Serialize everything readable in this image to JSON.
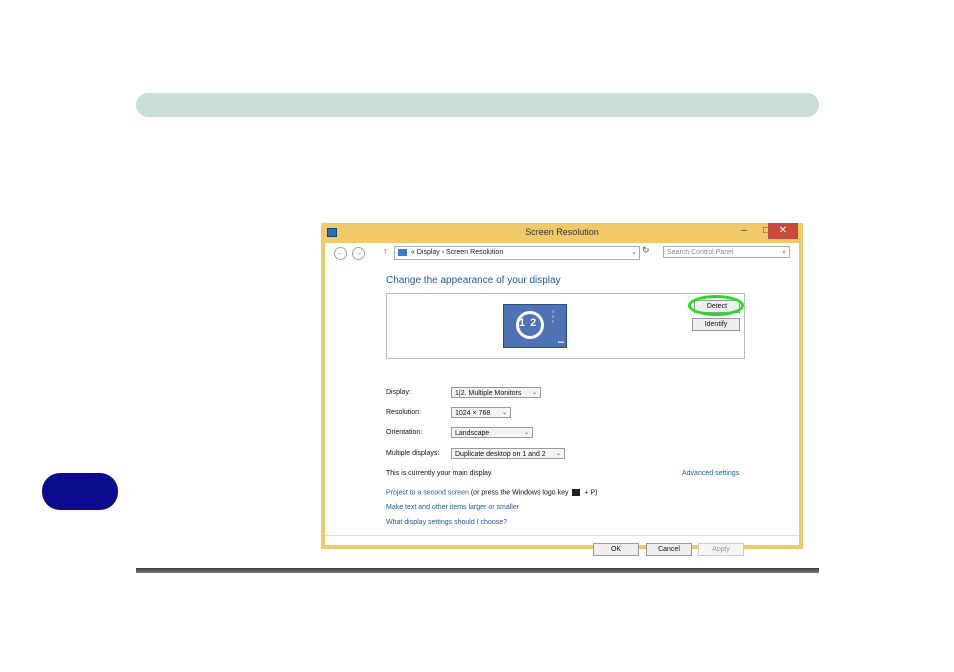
{
  "window": {
    "title": "Screen Resolution",
    "min_glyph": "–",
    "max_glyph": "□",
    "close_glyph": "✕"
  },
  "addressbar": {
    "back_glyph": "←",
    "forward_glyph": "→",
    "up_glyph": "↑",
    "breadcrumb": "«  Display  ›  Screen Resolution",
    "dropdown_glyph": "⌄",
    "refresh_glyph": "↻",
    "search_placeholder": "Search Control Panel",
    "search_icon": "magnifier-icon"
  },
  "main": {
    "heading": "Change the appearance of your display",
    "monitor_numbers": "1 2",
    "detect_label": "Detect",
    "identify_label": "Identify",
    "display_label": "Display:",
    "display_value": "1|2. Multiple Monitors",
    "resolution_label": "Resolution:",
    "resolution_value": "1024 × 768",
    "orientation_label": "Orientation:",
    "orientation_value": "Landscape",
    "multiple_label": "Multiple displays:",
    "multiple_value": "Duplicate desktop on 1 and 2",
    "main_display_text": "This is currently your main display.",
    "advanced_link": "Advanced settings",
    "project_link": "Project to a second screen",
    "project_rest_a": "(or press the Windows logo key",
    "project_rest_b": "+ P)",
    "larger_link": "Make text and other items larger or smaller",
    "what_link": "What display settings should I choose?"
  },
  "footer": {
    "ok": "OK",
    "cancel": "Cancel",
    "apply": "Apply"
  },
  "colors": {
    "frame": "#f2c968",
    "link": "#1e5aa8",
    "highlight": "#1ee01e",
    "side_tab": "#0b0b8e",
    "top_bar": "#c9ddd9"
  }
}
